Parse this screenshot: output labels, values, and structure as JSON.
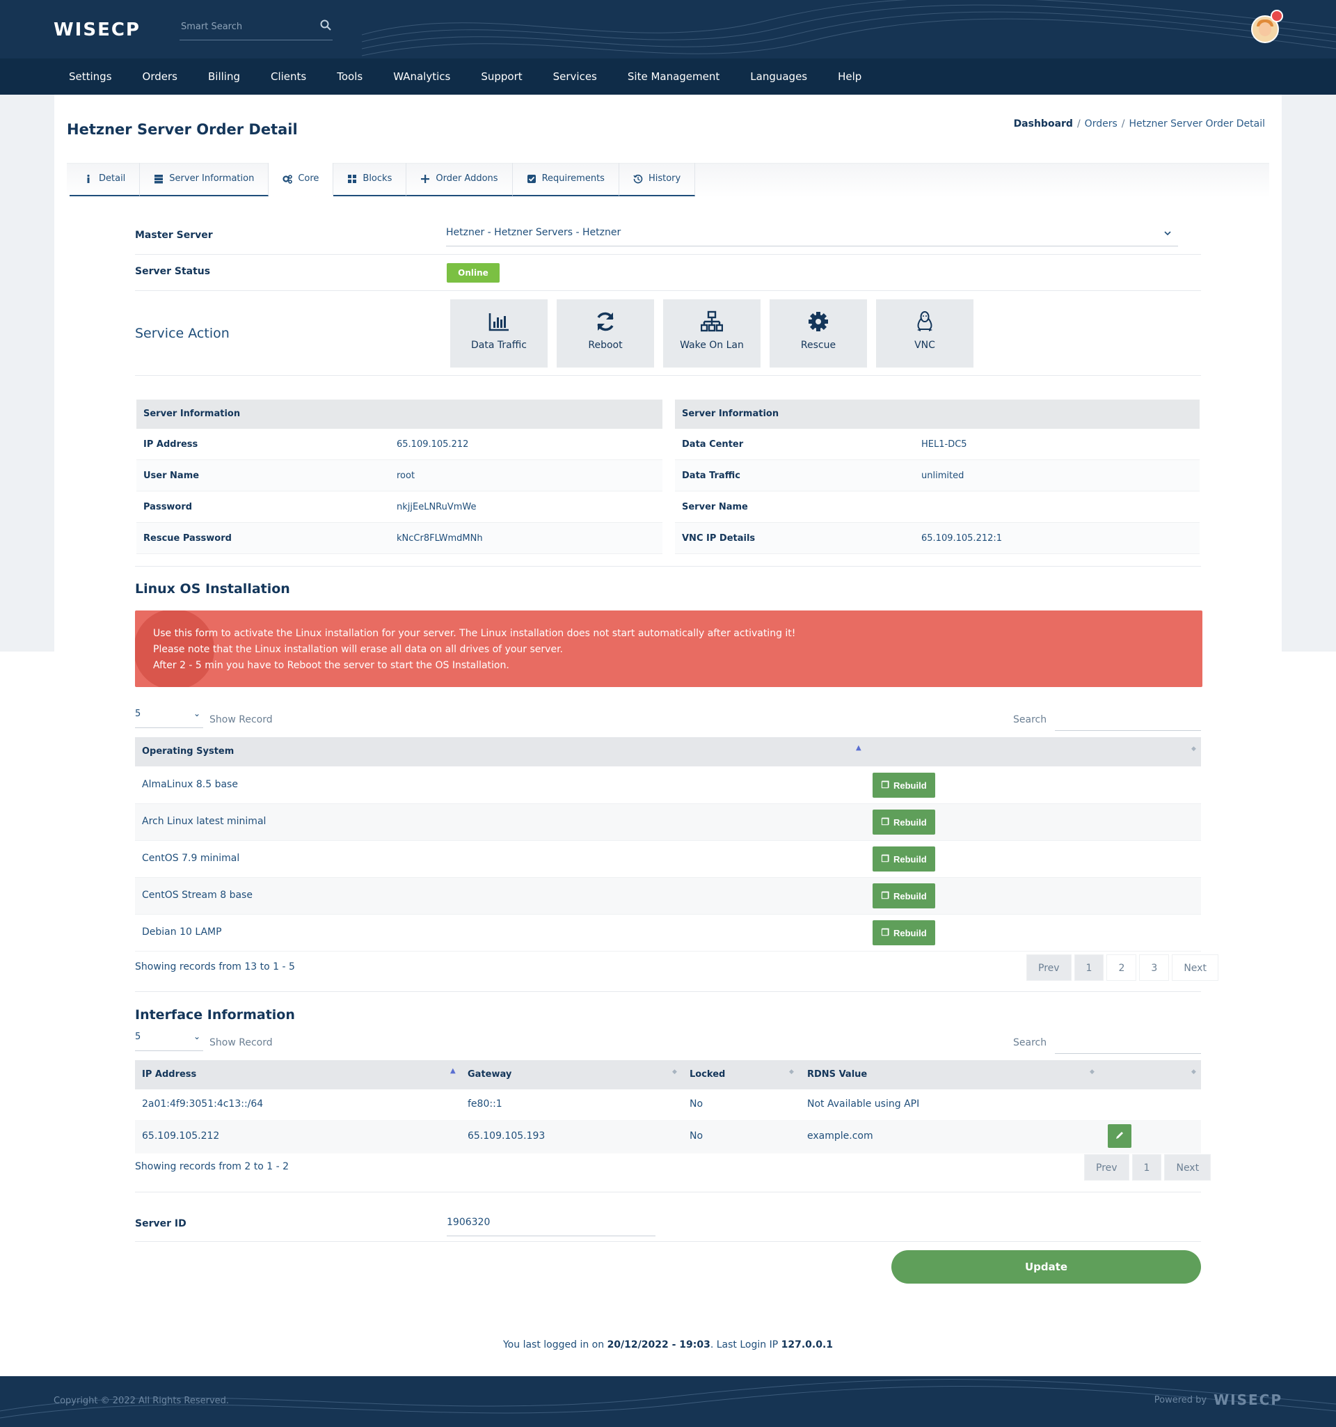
{
  "header": {
    "logo": "WISECP",
    "search_placeholder": "Smart Search"
  },
  "nav": [
    "Settings",
    "Orders",
    "Billing",
    "Clients",
    "Tools",
    "WAnalytics",
    "Support",
    "Services",
    "Site Management",
    "Languages",
    "Help"
  ],
  "page": {
    "title": "Hetzner Server Order Detail",
    "breadcrumb": [
      "Dashboard",
      "Orders",
      "Hetzner Server Order Detail"
    ]
  },
  "tabs": [
    {
      "label": "Detail",
      "icon": "info-icon"
    },
    {
      "label": "Server Information",
      "icon": "server-icon"
    },
    {
      "label": "Core",
      "icon": "cogs-icon"
    },
    {
      "label": "Blocks",
      "icon": "grid-icon"
    },
    {
      "label": "Order Addons",
      "icon": "plus-icon"
    },
    {
      "label": "Requirements",
      "icon": "checkbox-icon"
    },
    {
      "label": "History",
      "icon": "history-icon"
    }
  ],
  "form": {
    "master_server_label": "Master Server",
    "master_server_value": "Hetzner - Hetzner Servers - Hetzner",
    "server_status_label": "Server Status",
    "server_status_value": "Online",
    "service_action_label": "Service Action"
  },
  "actions": [
    {
      "label": "Data Traffic",
      "icon": "bar-chart-icon"
    },
    {
      "label": "Reboot",
      "icon": "refresh-icon"
    },
    {
      "label": "Wake On Lan",
      "icon": "network-icon"
    },
    {
      "label": "Rescue",
      "icon": "gear-icon"
    },
    {
      "label": "VNC",
      "icon": "linux-icon"
    }
  ],
  "server_info_left": {
    "title": "Server Information",
    "rows": [
      {
        "k": "IP Address",
        "v": "65.109.105.212"
      },
      {
        "k": "User Name",
        "v": "root"
      },
      {
        "k": "Password",
        "v": "nkjjEeLNRuVmWe"
      },
      {
        "k": "Rescue Password",
        "v": "kNcCr8FLWmdMNh"
      }
    ]
  },
  "server_info_right": {
    "title": "Server Information",
    "rows": [
      {
        "k": "Data Center",
        "v": "HEL1-DC5"
      },
      {
        "k": "Data Traffic",
        "v": "unlimited"
      },
      {
        "k": "Server Name",
        "v": ""
      },
      {
        "k": "VNC IP Details",
        "v": "65.109.105.212:1"
      }
    ]
  },
  "os_section": {
    "title": "Linux OS Installation",
    "alert_lines": [
      "Use this form to activate the Linux installation for your server. The Linux installation does not start automatically after activating it!",
      "Please note that the Linux installation will erase all data on all drives of your server.",
      "After 2 - 5 min you have to Reboot the server to start the OS Installation."
    ],
    "page_length": "5",
    "show_record": "Show Record",
    "search_label": "Search",
    "column": "Operating System",
    "rows": [
      "AlmaLinux 8.5 base",
      "Arch Linux latest minimal",
      "CentOS 7.9 minimal",
      "CentOS Stream 8 base",
      "Debian 10 LAMP"
    ],
    "rebuild_label": "Rebuild",
    "showing": "Showing records from 13 to 1 - 5",
    "pager": [
      "Prev",
      "1",
      "2",
      "3",
      "Next"
    ]
  },
  "interface_section": {
    "title": "Interface Information",
    "page_length": "5",
    "show_record": "Show Record",
    "search_label": "Search",
    "columns": [
      "IP Address",
      "Gateway",
      "Locked",
      "RDNS Value"
    ],
    "rows": [
      {
        "ip": "2a01:4f9:3051:4c13::/64",
        "gateway": "fe80::1",
        "locked": "No",
        "rdns": "Not Available using API"
      },
      {
        "ip": "65.109.105.212",
        "gateway": "65.109.105.193",
        "locked": "No",
        "rdns": "example.com"
      }
    ],
    "showing": "Showing records from 2 to 1 - 2",
    "pager": [
      "Prev",
      "1",
      "Next"
    ]
  },
  "server_id": {
    "label": "Server ID",
    "value": "1906320"
  },
  "update_label": "Update",
  "last_login": {
    "prefix": "You last logged in on ",
    "datetime": "20/12/2022 - 19:03",
    "middle": ". Last Login IP ",
    "ip": "127.0.0.1"
  },
  "footer": {
    "copyright": "Copyright © 2022 All Rights Reserved.",
    "powered_by": "Powered by",
    "powered_logo": "WISECP"
  },
  "colors": {
    "header_bg": "#163453",
    "nav_bg": "#0f2c48",
    "accent_green": "#5f9f5a",
    "online_green": "#7bc043",
    "alert_red": "#e86c62"
  }
}
